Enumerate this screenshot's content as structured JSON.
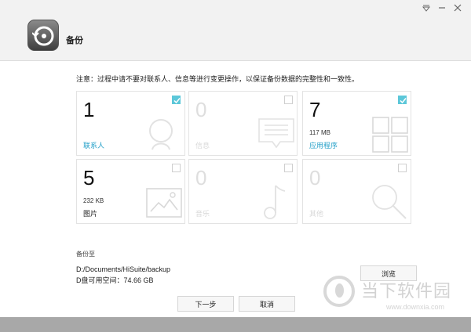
{
  "window": {
    "title": "备份",
    "controls": [
      "dropdown-icon",
      "minimize-icon",
      "close-icon"
    ]
  },
  "notice": "注意：过程中请不要对联系人、信息等进行变更操作，以保证备份数据的完整性和一致性。",
  "cards": [
    {
      "id": "contacts",
      "count": "1",
      "size": "",
      "label": "联系人",
      "checked": true,
      "enabled": true,
      "icon": "contact-icon"
    },
    {
      "id": "messages",
      "count": "0",
      "size": "",
      "label": "信息",
      "checked": false,
      "enabled": false,
      "icon": "message-icon"
    },
    {
      "id": "apps",
      "count": "7",
      "size": "117 MB",
      "label": "应用程序",
      "checked": true,
      "enabled": true,
      "icon": "apps-grid-icon"
    },
    {
      "id": "pictures",
      "count": "5",
      "size": "232 KB",
      "label": "图片",
      "checked": false,
      "enabled": true,
      "icon": "picture-icon"
    },
    {
      "id": "music",
      "count": "0",
      "size": "",
      "label": "音乐",
      "checked": false,
      "enabled": false,
      "icon": "music-note-icon"
    },
    {
      "id": "other",
      "count": "0",
      "size": "",
      "label": "其他",
      "checked": false,
      "enabled": false,
      "icon": "search-icon"
    }
  ],
  "destination": {
    "heading": "备份至",
    "path": "D:/Documents/HiSuite/backup",
    "free_space": "D盘可用空间：74.66 GB",
    "browse_label": "浏览"
  },
  "footer": {
    "next_label": "下一步",
    "cancel_label": "取消"
  },
  "watermark": {
    "text": "当下软件园",
    "url": "www.downxia.com"
  },
  "colors": {
    "accent": "#24a0c9",
    "checkbox_checked": "#5cc7d9",
    "card_border": "#e3e3e3",
    "header_bg": "#f2f2f2"
  }
}
